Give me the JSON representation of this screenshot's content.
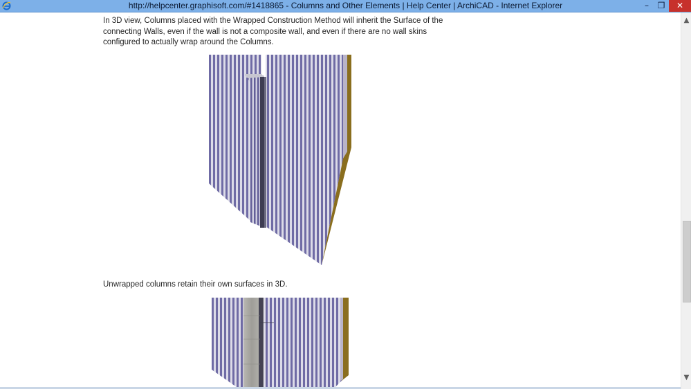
{
  "window": {
    "title": "http://helpcenter.graphisoft.com/#1418865 - Columns and Other Elements | Help Center | ArchiCAD - Internet Explorer",
    "controls": {
      "minimize": "–",
      "restore": "❐",
      "close": "✕"
    }
  },
  "content": {
    "paragraph_1": "In 3D view, Columns placed with the Wrapped Construction Method will inherit the Surface of the connecting Walls, even if the wall is not a composite wall, and even if there are no wall skins configured to actually wrap around the Columns.",
    "paragraph_2": "Unwrapped columns retain their own surfaces in 3D.",
    "figures": [
      {
        "name": "wrapped-column-render",
        "stripe_color": "#6e6aa4",
        "stripe_light": "#d9d8e6",
        "side_color": "#8c6f1e"
      },
      {
        "name": "unwrapped-column-render",
        "stripe_color": "#6e6aa4",
        "stripe_light": "#d9d8e6",
        "column_color": "#a8a8a4"
      }
    ]
  },
  "scrollbar": {
    "up_arrow": "▲",
    "down_arrow": "▼"
  }
}
